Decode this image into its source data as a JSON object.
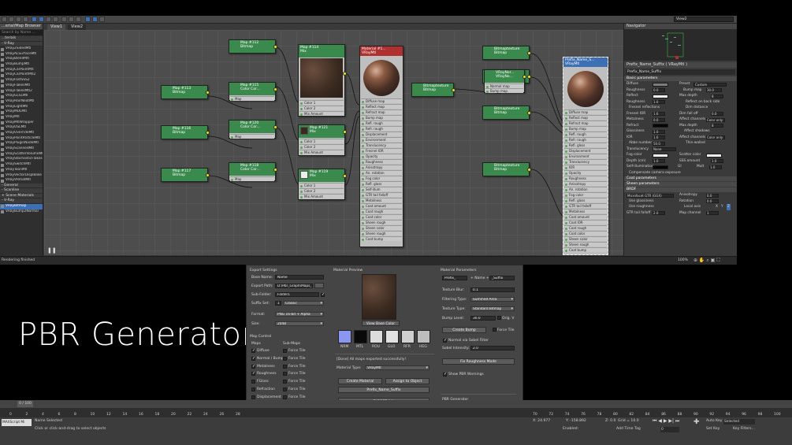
{
  "app": {
    "viewport_label": "View2",
    "tabs": [
      "View1",
      "View2"
    ],
    "status_msg": "Rendering finished"
  },
  "browser": {
    "title": "...erial/Map Browser",
    "search": "Search by Name ...",
    "groups": [
      "...terials",
      "- V-Ray",
      "- General",
      "- Scanline",
      "+ Scene Materials",
      "- V-Ray"
    ],
    "items": [
      "VRay2SidedMtl",
      "VRayALSurfaceMtl",
      "VRayBlendMtl",
      "VRayBumpMtl",
      "VRayCarPaintMtl",
      "VRayCarPaintMtl2",
      "VRayFastSSS2",
      "VRayFlakesMtl",
      "VRayFlakesMtl2",
      "VRayGLSLMtl",
      "VRayHairNextMtl",
      "VRayLightMtl",
      "VRayMDLMtl",
      "VRayMtl",
      "VRayMtlWrapper",
      "VRayOSLMtl",
      "VRayOverrideMtl",
      "VRayPointParticleMtl",
      "VRayPluginNodeMtl",
      "VRayScannedMtl",
      "VRayScatterVolumeMtl",
      "VRayStochasticFlakesMtl",
      "VRaySwitchMtl",
      "VRayToonMtl",
      "VRayVectorDisplBake",
      "VRayVRmatMtl"
    ],
    "scene_items": [
      "VRayBitmap",
      "VRayBump2Normal"
    ]
  },
  "nodes": {
    "map112": {
      "title": "Map #112",
      "sub": "Bitmap"
    },
    "map114": {
      "title": "Map #114",
      "sub": "Mix",
      "slots": [
        "Color 1",
        "Color 2",
        "Mix Amount"
      ]
    },
    "map113": {
      "title": "Map #113",
      "sub": "Bitmap"
    },
    "map115": {
      "title": "Map #115",
      "sub": "Color Cor...",
      "slot": "Map"
    },
    "map116": {
      "title": "Map #116",
      "sub": "Bitmap"
    },
    "map120": {
      "title": "Map #120",
      "sub": "Color Cor...",
      "slot": "Map"
    },
    "map121": {
      "title": "Map #121",
      "sub": "Mix",
      "slots": [
        "Color 1",
        "Color 2",
        "Mix Amount"
      ]
    },
    "map117": {
      "title": "Map #117",
      "sub": "Bitmap"
    },
    "map118": {
      "title": "Map #118",
      "sub": "Color Cor...",
      "slot": "Map"
    },
    "map119": {
      "title": "Map #119",
      "sub": "Mix",
      "slots": [
        "Color 1",
        "Color 2",
        "Mix Amount"
      ]
    },
    "material": {
      "title": "Material #1...",
      "sub": "VRayMtl"
    },
    "material_slots": [
      "Diffuse map",
      "Reflect map",
      "Refract map",
      "Bump map",
      "Refl. rough",
      "Refr. rough",
      "Displacement",
      "Environment",
      "Translucency",
      "Fresnel IOR",
      "Opacity",
      "Roughness",
      "Anisotropy",
      "An. rotation",
      "Fog color",
      "Refl. gloss",
      "Self-illum",
      "GTR tail falloff",
      "Metalness",
      "Coat amount",
      "Coat rough",
      "Coat color",
      "Sheen rough",
      "Sheen color",
      "Sheen rough",
      "Coat bump"
    ],
    "bmtex_mid": {
      "title": "Bitmaptexture",
      "sub": "Bitmap"
    },
    "bmtex_tr1": {
      "title": "Bitmaptexture",
      "sub": "Bitmap"
    },
    "bmtex_tr2": {
      "title": "Bitmaptexture",
      "sub": "Bitmap"
    },
    "bmtex_tr3": {
      "title": "Bitmaptexture",
      "sub": "Bitmap"
    },
    "vraynormal": {
      "title": "VRayNor...",
      "sub": "VRayNo...",
      "slots": [
        "Normal map",
        "Bump map"
      ]
    },
    "bmtex_r4": {
      "title": "Bitmaptexture",
      "sub": "Bitmap"
    },
    "prefix": {
      "title": "Prefix_Name_S...",
      "sub": "VRayMtl"
    },
    "prefix_slots": [
      "Diffuse map",
      "Reflect map",
      "Refract map",
      "Bump map",
      "Refl. rough",
      "Refr. rough",
      "Refl. gloss",
      "Displacement",
      "Environment",
      "Translucency",
      "IOR",
      "Opacity",
      "Roughness",
      "Anisotropy",
      "An. rotation",
      "Fog color",
      "Refl. gloss",
      "GTR tail falloff",
      "Metalness",
      "Coat amount",
      "Coat IOR",
      "Coat rough",
      "Coat color",
      "Sheen color",
      "Sheen rough",
      "Coat bump"
    ]
  },
  "sidebar": {
    "navigator": "Navigator",
    "pe_title": "Prefix_Name_Suffix ( VRayMtl )",
    "pe_name": "Prefix_Name_Suffix",
    "basic_params": "Basic parameters",
    "diffuse": "Diffuse",
    "preset": "Preset",
    "preset_val": "Custom",
    "roughness": "Roughness",
    "roughness_val": "0.0",
    "bump_map": "Bump map",
    "bump_val": "30.0",
    "reflect": "Reflect",
    "max_depth": "Max depth",
    "max_depth_val": "8",
    "refl_rough": "Roughness",
    "refl_rough_val": "1.0",
    "reflect_backside": "Reflect on back side",
    "fresnel": "Fresnel reflections",
    "dim_dist": "Dim distance",
    "fresnel_ior": "Fresnel IOR",
    "fresnel_ior_val": "1.6",
    "dim_falloff": "Dim fall off",
    "dim_falloff_val": "0.0",
    "metalness": "Metalness",
    "metalness_val": "0.0",
    "affect_ch": "Affect channels",
    "affect_ch_val": "Color only",
    "refract": "Refract",
    "refr_max_depth": "Max depth",
    "refr_max_depth_val": "8",
    "glossiness": "Glossiness",
    "glossiness_val": "1.0",
    "affect_shadows": "Affect shadows",
    "ior": "IOR",
    "ior_val": "1.6",
    "refr_affect": "Affect channels",
    "refr_affect_val": "Color only",
    "abbe": "Abbe number",
    "abbe_val": "50.0",
    "thin_walled": "Thin-walled",
    "translucency": "Translucency",
    "translucency_val": "None",
    "fog_color": "Fog color",
    "scatter_color": "Scatter color",
    "depth_cm": "Depth (cm)",
    "depth_val": "1.0",
    "sss_amount": "SSS amount",
    "sss_val": "1.0",
    "self_illum": "Self-illumination",
    "gi": "GI",
    "mult": "Mult",
    "mult_val": "1.0",
    "compensate": "Compensate camera exposure",
    "coat_params": "Coat parameters",
    "sheen_params": "Sheen parameters",
    "brdf": "BRDF",
    "brdf_type": "Microfacet GTR (GGX)",
    "anisotropy": "Anisotropy",
    "aniso_val": "0.0",
    "use_glossiness": "Use glossiness",
    "rotation": "Rotation",
    "rotation_val": "0.0",
    "use_roughness": "Use roughness",
    "local_axis": "Local axis",
    "local_x": "X",
    "local_y": "Y",
    "local_z": "Z",
    "gtr_tail": "GTR tail falloff",
    "gtr_val": "2.0",
    "map_channel": "Map channel",
    "map_channel_val": "1",
    "zoom": "100%"
  },
  "dialog": {
    "export_settings": "Export Settings",
    "base_name_label": "Base Name:",
    "base_name": "Name",
    "export_path_label": "Export Path:",
    "export_path": "D:\\Pbr_Graph\\Maps_Tx",
    "sub_folder_label": "Sub-Folder:",
    "sub_folder": "Folder1",
    "suffix_set_label": "Suffix Set:",
    "suffix_num": "1",
    "suffix_set": "Classic",
    "format_label": "Format:",
    "format": "PNG 16-bit + Alpha",
    "size_label": "Size:",
    "size": "2048",
    "map_control": "Map Control",
    "maps_header": "Maps",
    "submaps_header": "Sub-Maps",
    "maps": [
      "Diffuse",
      "Normal / Bump",
      "Metalness",
      "Roughness",
      "FGloss",
      "Refraction",
      "Displacement",
      "Opacity",
      "Sheen Rough"
    ],
    "submaps": [
      "Force Tile",
      "Force Tile",
      "Force Tile",
      "Force Tile",
      "Force Tile",
      "Force Tile",
      "Force Tile",
      "Force Tile",
      "Force Tile"
    ],
    "material_preview": "Material Preview",
    "view_base_color": "View Base Color",
    "chan_labels": [
      "NRM",
      "MTL",
      "ROU",
      "GLO",
      "RFR",
      "HEG"
    ],
    "done_msg": "[Done] All maps exported successfully!",
    "material_type_label": "Material Type:",
    "material_type": "VRayMtl",
    "create_material": "Create Material",
    "assign_to_object": "Assign to Object",
    "prefix_suffix_btn": "Prefix_Name_Suffix",
    "export_all": "EXPORT ALL",
    "material_params": "Material Parameters",
    "prefix": "Prefix_",
    "name_plus": "+ Name +",
    "suffix": "_Suffix",
    "texture_blur_label": "Texture Blur:",
    "texture_blur": "0.1",
    "filtering_label": "Filtering Type:",
    "filtering": "Summed Area",
    "texture_type_label": "Texture Type:",
    "texture_type": "Standard Bitmap",
    "bump_level_label": "Bump Level:",
    "bump_level": "30.0",
    "orig_v": "Orig. V",
    "create_bump": "Create Bump",
    "force_tile": "Force Tile",
    "normal_sobel": "Normal via Sobel Filter",
    "sobel_label": "Sobel Intensity:",
    "sobel": "2.0",
    "fix_roughness": "Fix Roughness Mode",
    "show_pbr": "Show PBR Warnings",
    "pbr_generator": "PBR Generator",
    "script_version": "Script version: 1.0 Full Edition.",
    "visit_page": "Visit product page..."
  },
  "overlay": {
    "title": "PBR Generator"
  },
  "timeline": {
    "frame": "0 / 100",
    "ticks": [
      "10",
      "15",
      "20",
      "25",
      "30",
      "35",
      "40",
      "45",
      "50",
      "55",
      "60",
      "65",
      "70",
      "75",
      "80",
      "85",
      "90",
      "95",
      "100"
    ],
    "ticks_left": [
      "0",
      "2",
      "4",
      "6",
      "8",
      "10",
      "12",
      "14",
      "16",
      "18",
      "20",
      "22",
      "24",
      "26",
      "28"
    ],
    "ticks_right": [
      "70",
      "72",
      "74",
      "76",
      "78",
      "80",
      "82",
      "84",
      "86",
      "88",
      "90",
      "92",
      "94",
      "96",
      "98",
      "100"
    ],
    "script_label": "MAXScript Mi",
    "name_selected": "Name Selected",
    "prompt": "Click or click-and-drag to select objects",
    "coord_x": "X: 24.977",
    "coord_y": "Y: -158.892",
    "coord_z": "Z: 0.0",
    "grid": "Grid = 10.0",
    "auto_key": "Auto Key",
    "selected": "Selected",
    "set_key": "Set Key",
    "key_filters": "Key Filters...",
    "enabled": "Enabled:",
    "add_time_tag": "Add Time Tag",
    "frame_num": "0"
  }
}
